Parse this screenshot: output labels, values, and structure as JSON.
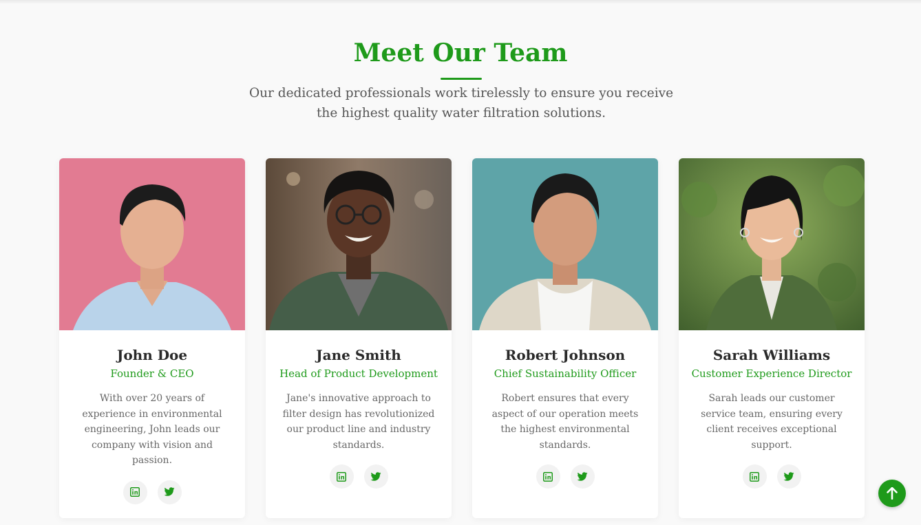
{
  "section": {
    "title": "Meet Our Team",
    "subtitle": "Our dedicated professionals work tirelessly to ensure you receive the highest quality water filtration solutions."
  },
  "colors": {
    "accent": "#1e9a1a",
    "background": "#f9f9f9",
    "card": "#ffffff"
  },
  "team": [
    {
      "name": "John Doe",
      "role": "Founder & CEO",
      "bio": "With over 20 years of experience in environmental engineering, John leads our company with vision and passion.",
      "photo_bg": "#e27b92",
      "icons": [
        "linkedin-icon",
        "twitter-icon"
      ]
    },
    {
      "name": "Jane Smith",
      "role": "Head of Product Development",
      "bio": "Jane's innovative approach to filter design has revolutionized our product line and industry standards.",
      "photo_bg": "#6a5a48",
      "icons": [
        "linkedin-icon",
        "twitter-icon"
      ]
    },
    {
      "name": "Robert Johnson",
      "role": "Chief Sustainability Officer",
      "bio": "Robert ensures that every aspect of our operation meets the highest environmental standards.",
      "photo_bg": "#5ea4a8",
      "icons": [
        "linkedin-icon",
        "twitter-icon"
      ]
    },
    {
      "name": "Sarah Williams",
      "role": "Customer Experience Director",
      "bio": "Sarah leads our customer service team, ensuring every client receives exceptional support.",
      "photo_bg": "#6d8f4a",
      "icons": [
        "linkedin-icon",
        "twitter-icon"
      ]
    }
  ],
  "back_to_top": {
    "icon": "arrow-up-icon"
  }
}
